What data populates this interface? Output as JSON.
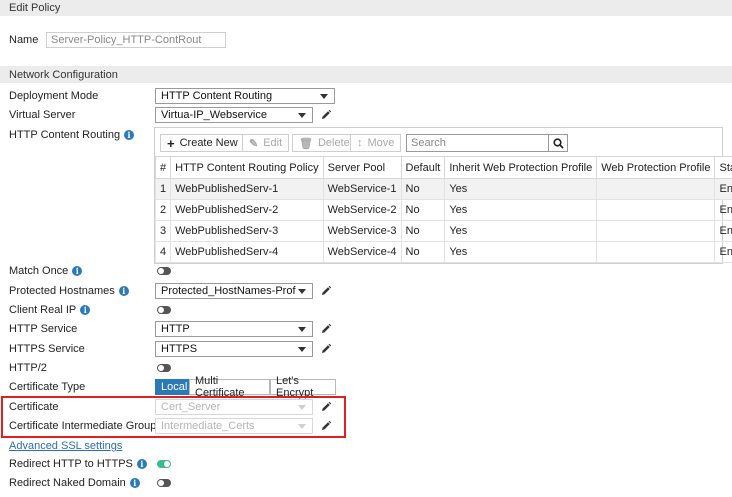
{
  "header": {
    "title": "Edit Policy"
  },
  "name_field": {
    "label": "Name",
    "placeholder": "Server-Policy_HTTP-ContRout"
  },
  "network_section": {
    "title": "Network Configuration"
  },
  "deployment_mode": {
    "label": "Deployment Mode",
    "value": "HTTP Content Routing"
  },
  "virtual_server": {
    "label": "Virtual Server",
    "value": "Virtua-IP_Webservice"
  },
  "content_routing": {
    "label": "HTTP Content Routing",
    "toolbar": {
      "create_new": "Create New",
      "edit": "Edit",
      "delete": "Delete",
      "move": "Move",
      "search_placeholder": "Search"
    },
    "columns": [
      "#",
      "HTTP Content Routing Policy",
      "Server Pool",
      "Default",
      "Inherit Web Protection Profile",
      "Web Protection Profile",
      "Status"
    ],
    "rows": [
      [
        "1",
        "WebPublishedServ-1",
        "WebService-1",
        "No",
        "Yes",
        "",
        "Enabled"
      ],
      [
        "2",
        "WebPublishedServ-2",
        "WebService-2",
        "No",
        "Yes",
        "",
        "Enabled"
      ],
      [
        "3",
        "WebPublishedServ-3",
        "WebService-3",
        "No",
        "Yes",
        "",
        "Enabled"
      ],
      [
        "4",
        "WebPublishedServ-4",
        "WebService-4",
        "No",
        "Yes",
        "",
        "Enabled"
      ]
    ]
  },
  "match_once": {
    "label": "Match Once",
    "enabled": false
  },
  "protected_hostnames": {
    "label": "Protected Hostnames",
    "value": "Protected_HostNames-Prof"
  },
  "client_real_ip": {
    "label": "Client Real IP",
    "enabled": false
  },
  "http_service": {
    "label": "HTTP Service",
    "value": "HTTP"
  },
  "https_service": {
    "label": "HTTPS Service",
    "value": "HTTPS"
  },
  "http2": {
    "label": "HTTP/2",
    "enabled": false
  },
  "certificate_type": {
    "label": "Certificate Type",
    "options": [
      "Local",
      "Multi Certificate",
      "Let's Encrypt"
    ],
    "selected": "Local"
  },
  "certificate": {
    "label": "Certificate",
    "value": "Cert_Server"
  },
  "cert_intermediate": {
    "label": "Certificate Intermediate Group",
    "value": "Intermediate_Certs"
  },
  "advanced_ssl": {
    "label": "Advanced SSL settings"
  },
  "redirect_http_https": {
    "label": "Redirect HTTP to HTTPS",
    "enabled": true
  },
  "redirect_naked": {
    "label": "Redirect Naked Domain",
    "enabled": false
  },
  "colors": {
    "accent": "#2a7ab8",
    "toggle_on": "#3fba8e",
    "highlight": "#e02020"
  }
}
